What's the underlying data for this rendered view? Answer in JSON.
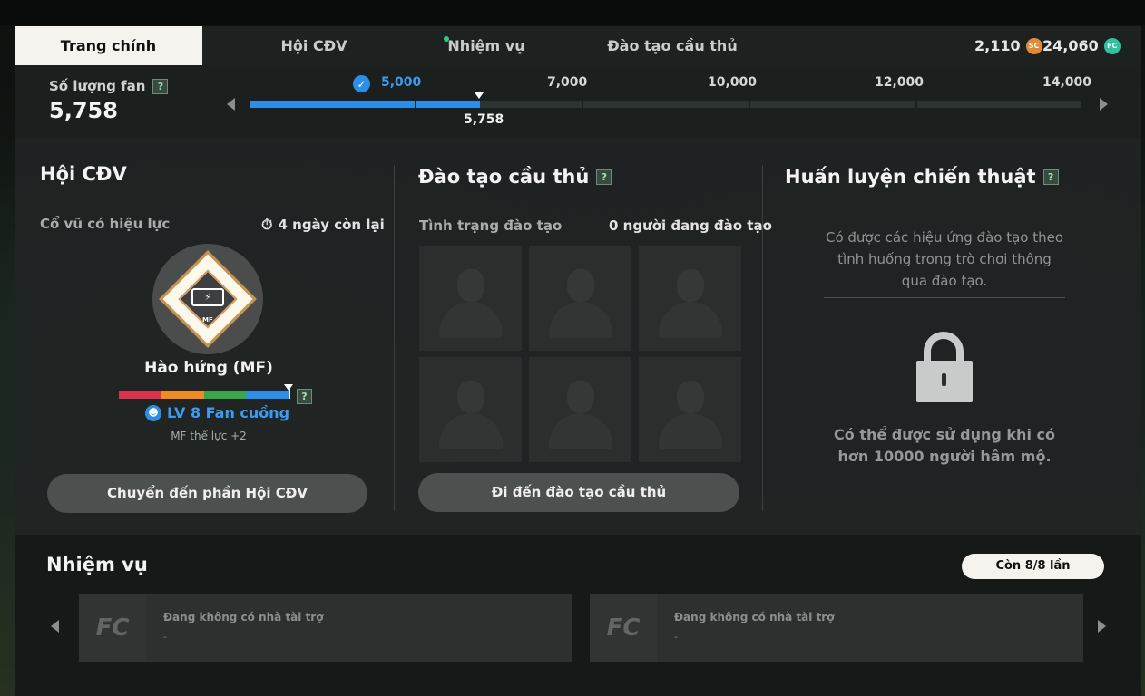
{
  "tabs": [
    {
      "label": "Trang chính",
      "active": true
    },
    {
      "label": "Hội CĐV",
      "active": false
    },
    {
      "label": "Nhiệm vụ",
      "active": false,
      "notification_dot": true
    },
    {
      "label": "Đào tạo cầu thủ",
      "active": false
    }
  ],
  "currency": {
    "sc_amount": "2,110",
    "sc_icon": "SC",
    "fc_amount": "24,060",
    "fc_icon": "FC"
  },
  "fans": {
    "label": "Số lượng fan",
    "value": "5,758",
    "help": "?",
    "milestones": [
      "5,000",
      "7,000",
      "10,000",
      "12,000",
      "14,000"
    ],
    "reached_milestone": "5,000",
    "current_label": "5,758",
    "progress_units": 5758
  },
  "fan_club": {
    "title": "Hội CĐV",
    "active_cheer_label": "Cổ vũ có hiệu lực",
    "time_left": "4 ngày còn lại",
    "emblem_tag": "MF",
    "badge_name": "Hào hứng (MF)",
    "help": "?",
    "level_label": "LV 8 Fan cuồng",
    "effect": "MF thể lực +2",
    "button": "Chuyển đến phần Hội CĐV",
    "colors": {
      "red": "#d8334a",
      "orange": "#ef8a25",
      "green": "#3aa64a",
      "blue": "#2d8ee8"
    }
  },
  "training": {
    "title": "Đào tạo cầu thủ",
    "help": "?",
    "status_label": "Tình trạng đào tạo",
    "count_label": "0 người đang đào tạo",
    "slots": 6,
    "button": "Đi đến đào tạo cầu thủ"
  },
  "tactics": {
    "title": "Huấn luyện chiến thuật",
    "help": "?",
    "description": "Có được các hiệu ứng đào tạo theo tình huống trong trò chơi thông qua đào tạo.",
    "locked_note": "Có thể được sử dụng khi có hơn 10000 người hâm mộ."
  },
  "missions": {
    "title": "Nhiệm vụ",
    "remaining": "Còn 8/8 lần",
    "cards": [
      {
        "logo": "FC",
        "text": "Đang không có nhà tài trợ",
        "sub": "-"
      },
      {
        "logo": "FC",
        "text": "Đang không có nhà tài trợ",
        "sub": "-"
      }
    ]
  }
}
